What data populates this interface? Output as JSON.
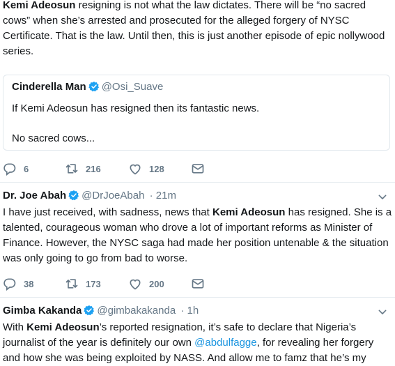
{
  "tweet1": {
    "body_lead_bold": "Kemi Adeosun",
    "body_rest": " resigning is not what the law dictates. There will be “no sacred cows” when she’s arrested and prosecuted for the alleged forgery of NYSC Certificate. That is the law. Until then, this is just another episode of epic nollywood series.",
    "quote": {
      "name": "Cinderella Man",
      "handle": "@Osi_Suave",
      "line1": "If Kemi Adeosun has resigned then its fantastic news.",
      "line2": "No sacred cows..."
    },
    "actions": {
      "replies": "6",
      "retweets": "216",
      "likes": "128"
    }
  },
  "tweet2": {
    "name": "Dr. Joe Abah",
    "handle": "@DrJoeAbah",
    "time": "· 21m",
    "body_pre": "I have just received, with sadness, news that ",
    "body_bold": "Kemi Adeosun",
    "body_post": " has resigned. She is a talented, courageous woman who drove a lot of important reforms as Minister of Finance. However, the NYSC saga had made her position untenable & the situation was only going to go from bad to worse.",
    "actions": {
      "replies": "38",
      "retweets": "173",
      "likes": "200"
    }
  },
  "tweet3": {
    "name": "Gimba Kakanda",
    "handle": "@gimbakakanda",
    "time": "· 1h",
    "body_pre": "With ",
    "body_bold": "Kemi Adeosun",
    "body_mid": "’s reported resignation, it’s safe to declare that Nigeria’s journalist of the year is definitely our own ",
    "body_mention": "@abdulfagge",
    "body_post": ", for revealing her forgery and how she was being exploited by NASS. And allow me to famz that he’s my"
  },
  "colors": {
    "accent": "#1da1f2",
    "muted": "#657786",
    "divider": "#e6ecf0"
  }
}
